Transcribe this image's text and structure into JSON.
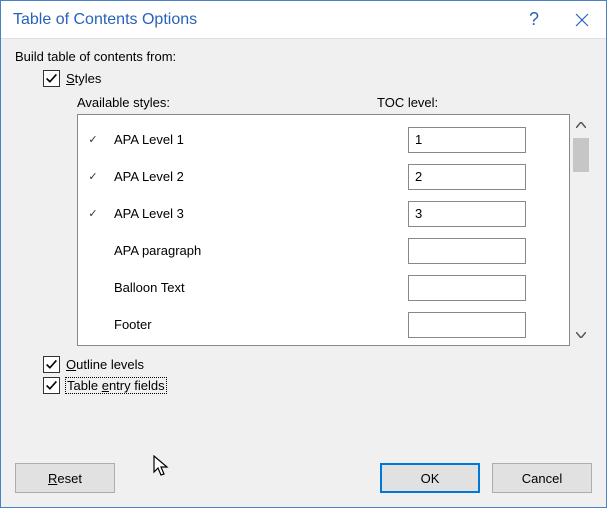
{
  "dialog": {
    "title": "Table of Contents Options",
    "help_glyph": "?",
    "close_glyph": "✕"
  },
  "heading": "Build table of contents from:",
  "styles_checkbox": {
    "checked": true,
    "label_prefix": "S",
    "label_rest": "tyles"
  },
  "columns": {
    "available": "Available styles:",
    "toc_level": "TOC level:"
  },
  "styles": [
    {
      "checked": true,
      "name": "APA Level 1",
      "level": "1"
    },
    {
      "checked": true,
      "name": "APA Level 2",
      "level": "2"
    },
    {
      "checked": true,
      "name": "APA Level 3",
      "level": "3"
    },
    {
      "checked": false,
      "name": "APA paragraph",
      "level": ""
    },
    {
      "checked": false,
      "name": "Balloon Text",
      "level": ""
    },
    {
      "checked": false,
      "name": "Footer",
      "level": ""
    }
  ],
  "outline_levels": {
    "checked": true,
    "label_prefix": "O",
    "label_rest": "utline levels"
  },
  "table_entry_fields": {
    "checked": true,
    "label_prefix": "Table ",
    "label_ul": "e",
    "label_rest": "ntry fields"
  },
  "buttons": {
    "reset_prefix": "R",
    "reset_rest": "eset",
    "ok": "OK",
    "cancel": "Cancel"
  },
  "checkmark": "✓"
}
